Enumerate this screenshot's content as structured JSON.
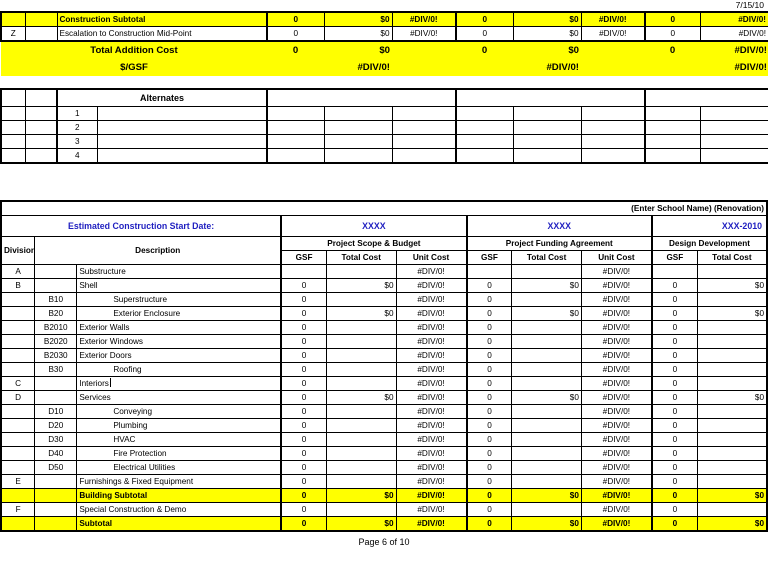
{
  "meta": {
    "date_stamp": "7/15/10",
    "footer": "Page 6 of 10",
    "accent_highlight": "#FFFF00",
    "accent_blue": "#1F1FC0"
  },
  "top_block": {
    "rows": [
      {
        "division": "",
        "code": "",
        "description": "Construction Subtotal",
        "highlight": true,
        "bold": true,
        "cells": [
          "0",
          "$0",
          "#DIV/0!",
          "0",
          "$0",
          "#DIV/0!",
          "0",
          "#DIV/0!"
        ]
      },
      {
        "division": "Z",
        "code": "",
        "description": "Escalation to Construction Mid-Point",
        "highlight": false,
        "bold": false,
        "cells": [
          "0",
          "$0",
          "#DIV/0!",
          "0",
          "$0",
          "#DIV/0!",
          "0",
          "#DIV/0!"
        ]
      }
    ],
    "total_addition": {
      "label": "Total Addition Cost",
      "cells": [
        "0",
        "$0",
        "",
        "0",
        "$0",
        "",
        "0",
        "#DIV/0!"
      ]
    },
    "per_gsf": {
      "label": "$/GSF",
      "cells": [
        "",
        "#DIV/0!",
        "",
        "",
        "#DIV/0!",
        "",
        "",
        "#DIV/0!"
      ]
    }
  },
  "alternates": {
    "header_label": "Alternates",
    "rows": [
      {
        "number": "1"
      },
      {
        "number": "2"
      },
      {
        "number": "3"
      },
      {
        "number": "4"
      }
    ]
  },
  "main_table": {
    "title": "(Enter School Name) (Renovation)",
    "start_date": {
      "label": "Estimated Construction Start Date:",
      "values": [
        "XXXX",
        "XXXX",
        "XXX-2010"
      ]
    },
    "column_groups": [
      "Project Scope & Budget",
      "Project Funding Agreement",
      "Design Development"
    ],
    "subheaders": [
      "GSF",
      "Total Cost",
      "Unit Cost",
      "GSF",
      "Total Cost",
      "Unit Cost",
      "GSF",
      "Total Cost"
    ],
    "left_headers": {
      "division": "Division #",
      "description": "Description"
    },
    "rows": [
      {
        "division": "A",
        "code": "",
        "description": "Substructure",
        "indent": 1,
        "highlight": false,
        "bold": false,
        "cursor": false,
        "cells": [
          "",
          "",
          "#DIV/0!",
          "",
          "",
          "#DIV/0!",
          "",
          ""
        ]
      },
      {
        "division": "B",
        "code": "",
        "description": "Shell",
        "indent": 1,
        "highlight": false,
        "bold": false,
        "cursor": false,
        "cells": [
          "0",
          "$0",
          "#DIV/0!",
          "0",
          "$0",
          "#DIV/0!",
          "0",
          "$0"
        ]
      },
      {
        "division": "",
        "code": "B10",
        "description": "Superstructure",
        "indent": 2,
        "highlight": false,
        "bold": false,
        "cursor": false,
        "cells": [
          "0",
          "",
          "#DIV/0!",
          "0",
          "",
          "#DIV/0!",
          "0",
          ""
        ]
      },
      {
        "division": "",
        "code": "B20",
        "description": "Exterior Enclosure",
        "indent": 2,
        "highlight": false,
        "bold": false,
        "cursor": false,
        "cells": [
          "0",
          "$0",
          "#DIV/0!",
          "0",
          "$0",
          "#DIV/0!",
          "0",
          "$0"
        ]
      },
      {
        "division": "",
        "code": "B2010",
        "description": "Exterior Walls",
        "indent": 3,
        "highlight": false,
        "bold": false,
        "cursor": false,
        "cells": [
          "0",
          "",
          "#DIV/0!",
          "0",
          "",
          "#DIV/0!",
          "0",
          ""
        ]
      },
      {
        "division": "",
        "code": "B2020",
        "description": "Exterior Windows",
        "indent": 3,
        "highlight": false,
        "bold": false,
        "cursor": false,
        "cells": [
          "0",
          "",
          "#DIV/0!",
          "0",
          "",
          "#DIV/0!",
          "0",
          ""
        ]
      },
      {
        "division": "",
        "code": "B2030",
        "description": "Exterior Doors",
        "indent": 3,
        "highlight": false,
        "bold": false,
        "cursor": false,
        "cells": [
          "0",
          "",
          "#DIV/0!",
          "0",
          "",
          "#DIV/0!",
          "0",
          ""
        ]
      },
      {
        "division": "",
        "code": "B30",
        "description": "Roofing",
        "indent": 2,
        "highlight": false,
        "bold": false,
        "cursor": false,
        "cells": [
          "0",
          "",
          "#DIV/0!",
          "0",
          "",
          "#DIV/0!",
          "0",
          ""
        ]
      },
      {
        "division": "C",
        "code": "",
        "description": "Interiors",
        "indent": 1,
        "highlight": false,
        "bold": false,
        "cursor": true,
        "cells": [
          "0",
          "",
          "#DIV/0!",
          "0",
          "",
          "#DIV/0!",
          "0",
          ""
        ]
      },
      {
        "division": "D",
        "code": "",
        "description": "Services",
        "indent": 1,
        "highlight": false,
        "bold": false,
        "cursor": false,
        "cells": [
          "0",
          "$0",
          "#DIV/0!",
          "0",
          "$0",
          "#DIV/0!",
          "0",
          "$0"
        ]
      },
      {
        "division": "",
        "code": "D10",
        "description": "Conveying",
        "indent": 2,
        "highlight": false,
        "bold": false,
        "cursor": false,
        "cells": [
          "0",
          "",
          "#DIV/0!",
          "0",
          "",
          "#DIV/0!",
          "0",
          ""
        ]
      },
      {
        "division": "",
        "code": "D20",
        "description": "Plumbing",
        "indent": 2,
        "highlight": false,
        "bold": false,
        "cursor": false,
        "cells": [
          "0",
          "",
          "#DIV/0!",
          "0",
          "",
          "#DIV/0!",
          "0",
          ""
        ]
      },
      {
        "division": "",
        "code": "D30",
        "description": "HVAC",
        "indent": 2,
        "highlight": false,
        "bold": false,
        "cursor": false,
        "cells": [
          "0",
          "",
          "#DIV/0!",
          "0",
          "",
          "#DIV/0!",
          "0",
          ""
        ]
      },
      {
        "division": "",
        "code": "D40",
        "description": "Fire Protection",
        "indent": 2,
        "highlight": false,
        "bold": false,
        "cursor": false,
        "cells": [
          "0",
          "",
          "#DIV/0!",
          "0",
          "",
          "#DIV/0!",
          "0",
          ""
        ]
      },
      {
        "division": "",
        "code": "D50",
        "description": "Electrical Utilities",
        "indent": 2,
        "highlight": false,
        "bold": false,
        "cursor": false,
        "cells": [
          "0",
          "",
          "#DIV/0!",
          "0",
          "",
          "#DIV/0!",
          "0",
          ""
        ]
      },
      {
        "division": "E",
        "code": "",
        "description": "Furnishings & Fixed Equipment",
        "indent": 1,
        "highlight": false,
        "bold": false,
        "cursor": false,
        "cells": [
          "0",
          "",
          "#DIV/0!",
          "0",
          "",
          "#DIV/0!",
          "0",
          ""
        ]
      },
      {
        "division": "",
        "code": "",
        "description": "Building Subtotal",
        "indent": 1,
        "highlight": true,
        "bold": true,
        "cursor": false,
        "cells": [
          "0",
          "$0",
          "#DIV/0!",
          "0",
          "$0",
          "#DIV/0!",
          "0",
          "$0"
        ]
      },
      {
        "division": "F",
        "code": "",
        "description": "Special Construction & Demo",
        "indent": 1,
        "highlight": false,
        "bold": false,
        "cursor": false,
        "cells": [
          "0",
          "",
          "#DIV/0!",
          "0",
          "",
          "#DIV/0!",
          "0",
          ""
        ]
      },
      {
        "division": "",
        "code": "",
        "description": "Subtotal",
        "indent": 1,
        "highlight": true,
        "bold": true,
        "cursor": false,
        "cells": [
          "0",
          "$0",
          "#DIV/0!",
          "0",
          "$0",
          "#DIV/0!",
          "0",
          "$0"
        ]
      }
    ]
  }
}
